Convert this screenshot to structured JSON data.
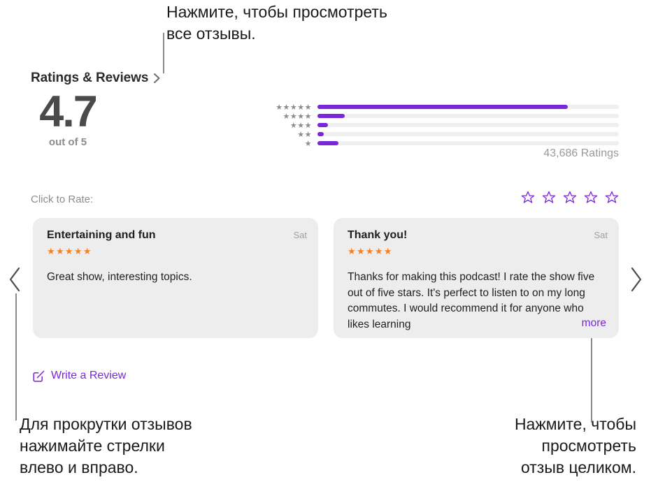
{
  "callouts": {
    "top": "Нажмите, чтобы просмотреть\nвсе отзывы.",
    "bottom_left": "Для прокрутки отзывов\nнажимайте стрелки\nвлево и вправо.",
    "bottom_right": "Нажмите, чтобы\nпросмотреть\nотзыв целиком."
  },
  "colors": {
    "accent_purple": "#7a26d9",
    "star_orange": "#f58220",
    "card_gray": "#ededed",
    "track_gray": "#efefef",
    "muted_text": "#8c8c8c"
  },
  "header": {
    "title": "Ratings & Reviews",
    "chevron_icon": "chevron-right-icon"
  },
  "score": {
    "value": "4.7",
    "out_of": "out of 5"
  },
  "histogram": {
    "ratings_count": "43,686 Ratings",
    "rows": [
      {
        "stars_label": "★★★★★",
        "stars": 5,
        "percent": 83
      },
      {
        "stars_label": "★★★★",
        "stars": 4,
        "percent": 9
      },
      {
        "stars_label": "★★★",
        "stars": 3,
        "percent": 3.5
      },
      {
        "stars_label": "★★",
        "stars": 2,
        "percent": 2
      },
      {
        "stars_label": "★",
        "stars": 1,
        "percent": 7
      }
    ]
  },
  "rate": {
    "label": "Click to Rate:",
    "stars": [
      "star-outline-icon",
      "star-outline-icon",
      "star-outline-icon",
      "star-outline-icon",
      "star-outline-icon"
    ]
  },
  "reviews": [
    {
      "title": "Entertaining and fun",
      "date": "Sat",
      "stars_label": "★★★★★",
      "body": "Great show, interesting topics.",
      "more_label": ""
    },
    {
      "title": "Thank you!",
      "date": "Sat",
      "stars_label": "★★★★★",
      "body": "Thanks for making this podcast! I rate the show five out of five stars. It's perfect to listen to on my long commutes. I would recommend it for anyone who likes learning",
      "more_label": "more"
    }
  ],
  "write_review": {
    "label": "Write a Review",
    "icon": "compose-icon"
  },
  "nav": {
    "prev_icon": "chevron-left-icon",
    "next_icon": "chevron-right-icon"
  }
}
